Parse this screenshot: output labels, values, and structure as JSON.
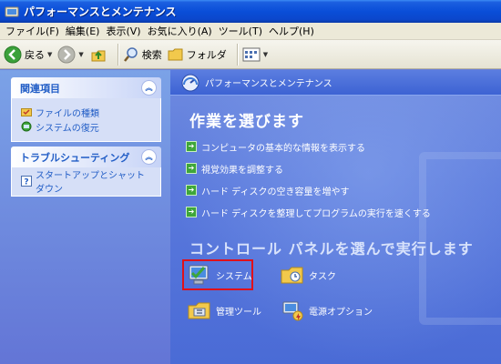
{
  "window": {
    "title": "パフォーマンスとメンテナンス"
  },
  "menu": [
    "ファイル(F)",
    "編集(E)",
    "表示(V)",
    "お気に入り(A)",
    "ツール(T)",
    "ヘルプ(H)"
  ],
  "toolbar": {
    "back_label": "戻る",
    "search_label": "検索",
    "folder_label": "フォルダ"
  },
  "left": {
    "related": {
      "title": "関連項目",
      "items": [
        "ファイルの種類",
        "システムの復元"
      ]
    },
    "troubleshoot": {
      "title": "トラブルシューティング",
      "items": [
        "スタートアップとシャットダウン"
      ]
    }
  },
  "content": {
    "header": "パフォーマンスとメンテナンス",
    "task_title": "作業を選びます",
    "tasks": [
      "コンピュータの基本的な情報を表示する",
      "視覚効果を調整する",
      "ハード ディスクの空き容量を増やす",
      "ハード ディスクを整理してプログラムの実行を速くする"
    ],
    "cp_title": "コントロール パネルを選んで実行します",
    "cp_items": [
      "システム",
      "タスク",
      "管理ツール",
      "電源オプション"
    ]
  },
  "colors": {
    "titlebar": "#0a4ed8",
    "content_bg": "#5a79dc",
    "highlight": "#e0101a"
  }
}
